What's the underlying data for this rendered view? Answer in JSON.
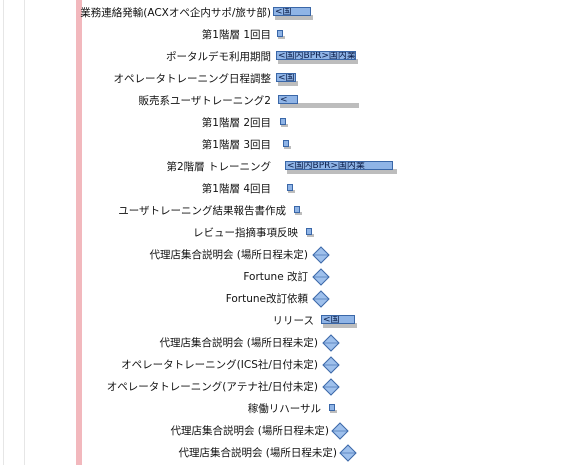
{
  "colors": {
    "bar_fill": "#8fb4e6",
    "bar_border": "#3a67a8",
    "shadow": "#bdbdbd",
    "today_line": "#f2b8bd",
    "grid": "#e6e6e6",
    "milestone_fill": "#9ec0ec",
    "milestone_border": "#3a67a8"
  },
  "tasks": [
    {
      "label": "業務連絡発輸(ACXオペ企内サポ/旅サ部)",
      "kind": "bar",
      "bar_text": "<国"
    },
    {
      "label": "第1階層 1回目",
      "kind": "mini",
      "bar_text": ""
    },
    {
      "label": "ポータルデモ利用期間",
      "kind": "bar",
      "bar_text": "<国内BPR>国内業"
    },
    {
      "label": "オペレータトレーニング日程調整",
      "kind": "bar",
      "bar_text": "<国"
    },
    {
      "label": "販売系ユーザトレーニング2",
      "kind": "bar",
      "bar_text": "<"
    },
    {
      "label": "第1階層 2回目",
      "kind": "mini",
      "bar_text": ""
    },
    {
      "label": "第1階層 3回目",
      "kind": "mini",
      "bar_text": ""
    },
    {
      "label": "第2階層 トレーニング",
      "kind": "bar",
      "bar_text": "<国内BPR>国内業"
    },
    {
      "label": "第1階層 4回目",
      "kind": "mini",
      "bar_text": ""
    },
    {
      "label": "ユーザトレーニング結果報告書作成",
      "kind": "mini",
      "bar_text": ""
    },
    {
      "label": "レビュー指摘事項反映",
      "kind": "mini",
      "bar_text": ""
    },
    {
      "label": "代理店集合説明会 (場所日程未定)",
      "kind": "milestone",
      "bar_text": ""
    },
    {
      "label": "Fortune 改訂",
      "kind": "milestone",
      "bar_text": ""
    },
    {
      "label": "Fortune改訂依頼",
      "kind": "milestone",
      "bar_text": ""
    },
    {
      "label": "リリース",
      "kind": "bar",
      "bar_text": "<国"
    },
    {
      "label": "代理店集合説明会 (場所日程未定)",
      "kind": "milestone",
      "bar_text": ""
    },
    {
      "label": "オペレータトレーニング(ICS社/日付未定)",
      "kind": "milestone",
      "bar_text": ""
    },
    {
      "label": "オペレータトレーニング(アテナ社/日付未定)",
      "kind": "milestone",
      "bar_text": ""
    },
    {
      "label": "稼働リハーサル",
      "kind": "mini",
      "bar_text": ""
    },
    {
      "label": "代理店集合説明会 (場所日程未定)",
      "kind": "milestone",
      "bar_text": ""
    },
    {
      "label": "代理店集合説明会 (場所日程未定)",
      "kind": "milestone",
      "bar_text": ""
    }
  ]
}
